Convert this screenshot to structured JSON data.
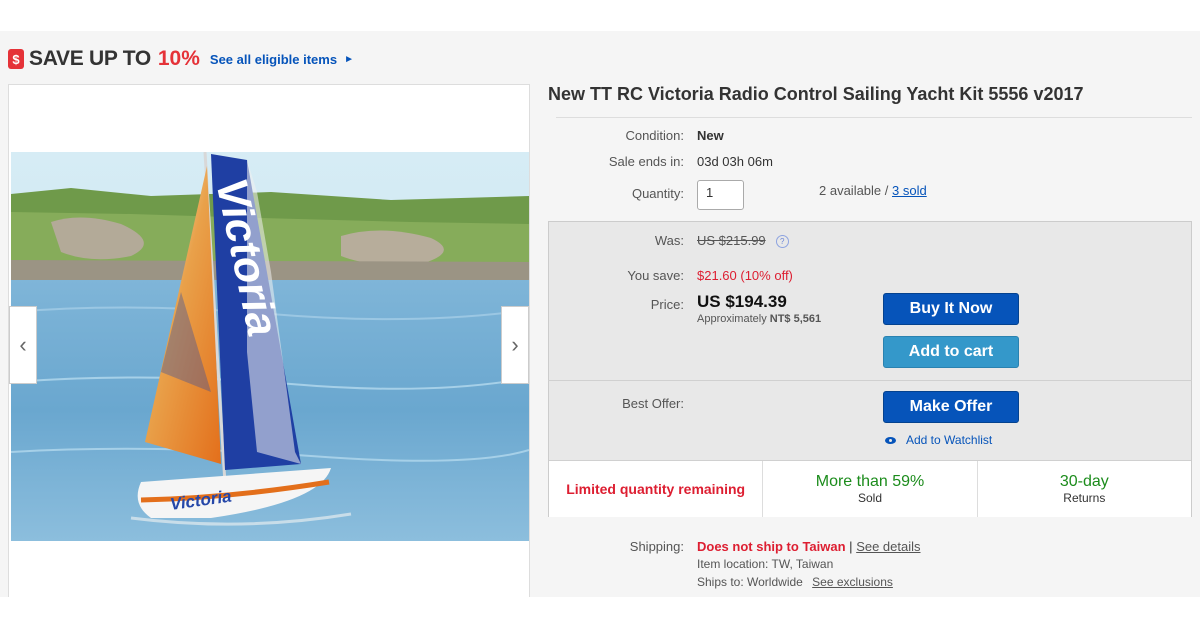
{
  "banner": {
    "tag_icon": "$",
    "save_text": "SAVE UP TO",
    "percent": "10%",
    "eligible_link": "See all eligible items",
    "arrow": "►"
  },
  "gallery": {
    "prev": "‹",
    "next": "›"
  },
  "listing": {
    "title": "New TT RC Victoria Radio Control Sailing Yacht Kit 5556 v2017",
    "condition_label": "Condition:",
    "condition_value": "New",
    "sale_ends_label": "Sale ends in:",
    "sale_ends_value": "03d 03h 06m",
    "quantity_label": "Quantity:",
    "quantity_value": "1",
    "available_text": "2 available /",
    "sold_link": "3 sold"
  },
  "pricing": {
    "was_label": "Was:",
    "was_value": "US $215.99",
    "you_save_label": "You save:",
    "you_save_value": "$21.60 (10% off)",
    "price_label": "Price:",
    "price_value": "US $194.39",
    "approx_prefix": "Approximately",
    "approx_value": "NT$ 5,561",
    "buy_now": "Buy It Now",
    "add_to_cart": "Add to cart",
    "best_offer_label": "Best Offer:",
    "make_offer": "Make Offer",
    "watchlist": "Add to Watchlist"
  },
  "stats": {
    "limited": "Limited quantity remaining",
    "sold_pct": "More than 59%",
    "sold_label": "Sold",
    "returns_value": "30-day",
    "returns_label": "Returns"
  },
  "shipping": {
    "label": "Shipping:",
    "status": "Does not ship to Taiwan",
    "separator": "|",
    "details_link": "See details",
    "item_location": "Item location:  TW, Taiwan",
    "ships_to": "Ships to:  Worldwide",
    "exclusions_link": "See exclusions"
  },
  "image": {
    "sail_text": "Victoria",
    "hull_text": "Victoria"
  },
  "colors": {
    "accent_red": "#e53238",
    "link_blue": "#0654ba",
    "button_light": "#3498ca",
    "stat_green": "#1c8c1c"
  }
}
